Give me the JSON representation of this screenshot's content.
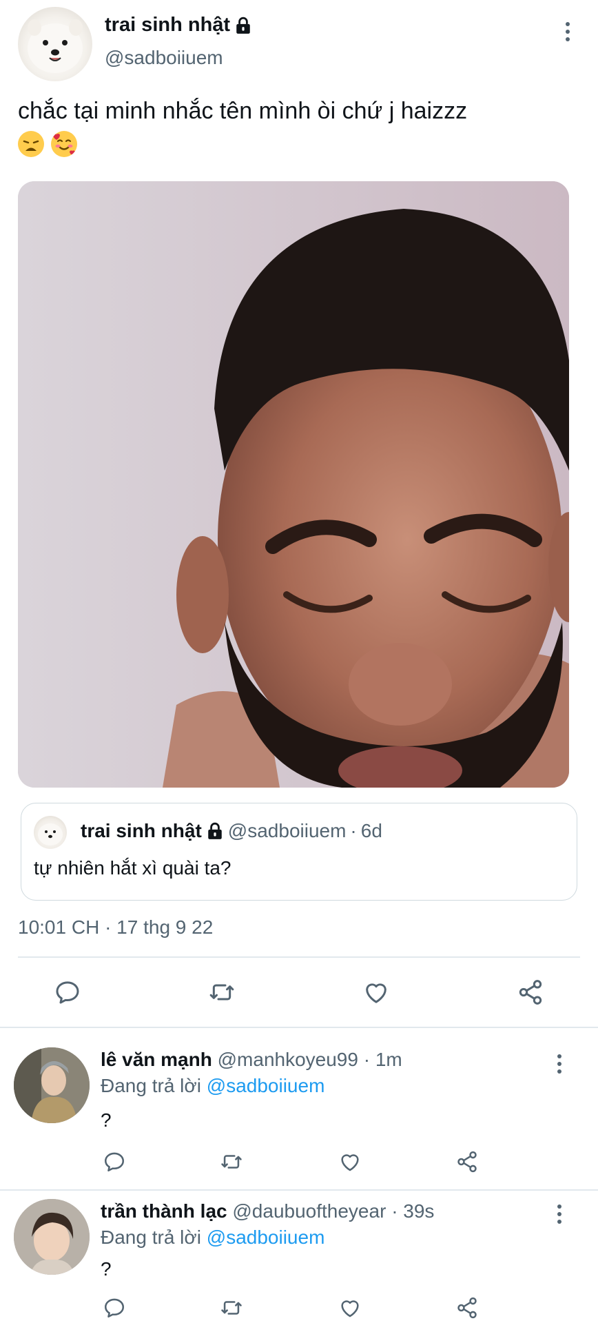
{
  "tweet": {
    "author_name": "trai sinh nhật",
    "author_handle": "@sadboiiuem",
    "text": "chắc tại minh nhắc tên mình òi chứ j haizzz",
    "emojis": [
      "weary-face",
      "smiling-face-with-hearts"
    ],
    "quoted": {
      "author_name": "trai sinh nhật",
      "author_handle": "@sadboiiuem",
      "separator": "·",
      "age": "6d",
      "text": "tự nhiên hắt xì quài ta?"
    },
    "timestamp": "10:01 CH · 17 thg 9 22",
    "actions": [
      "reply-icon",
      "retweet-icon",
      "like-icon",
      "share-icon"
    ]
  },
  "replies": [
    {
      "author_name": "lê văn mạnh",
      "author_handle": "@manhkoyeu99",
      "age": "· 1m",
      "replying_prefix": "Đang trả lời ",
      "replying_to": "@sadboiiuem",
      "text": "?"
    },
    {
      "author_name": "trần thành lạc",
      "author_handle": "@daubuoftheyear",
      "age": "· 39s",
      "replying_prefix": "Đang trả lời ",
      "replying_to": "@sadboiiuem",
      "text": "?"
    }
  ],
  "colors": {
    "text": "#0f1419",
    "muted": "#536471",
    "link": "#1d9bf0",
    "border": "#cfd9de"
  }
}
